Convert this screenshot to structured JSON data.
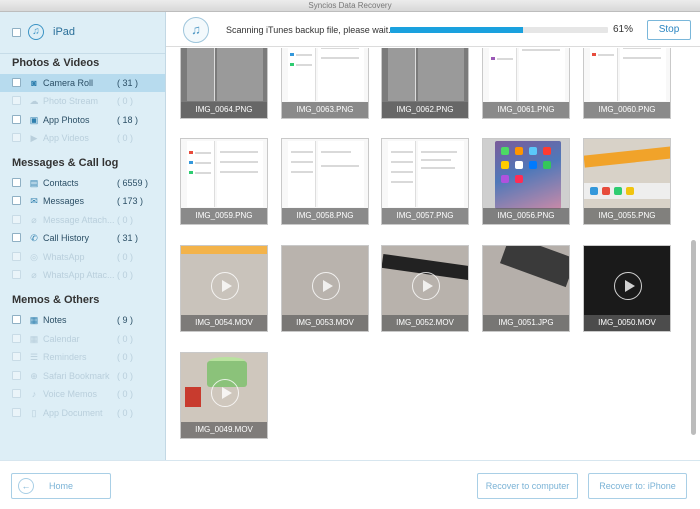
{
  "window": {
    "title": "Syncios Data Recovery"
  },
  "sidebar": {
    "device": {
      "name": "iPad",
      "icon": "music-note-icon"
    },
    "sections": [
      {
        "title": "Photos & Videos"
      },
      {
        "title": "Messages & Call log"
      },
      {
        "title": "Memos & Others"
      }
    ],
    "items": [
      {
        "label": "Camera Roll",
        "count": "( 31 )",
        "icon": "camera-icon"
      },
      {
        "label": "Photo Stream",
        "count": "( 0 )",
        "icon": "cloud-icon"
      },
      {
        "label": "App Photos",
        "count": "( 18 )",
        "icon": "image-icon"
      },
      {
        "label": "App Videos",
        "count": "( 0 )",
        "icon": "video-icon"
      },
      {
        "label": "Contacts",
        "count": "( 6559 )",
        "icon": "contacts-icon"
      },
      {
        "label": "Messages",
        "count": "( 173 )",
        "icon": "message-icon"
      },
      {
        "label": "Message Attach...",
        "count": "( 0 )",
        "icon": "attachment-icon"
      },
      {
        "label": "Call History",
        "count": "( 31 )",
        "icon": "phone-icon"
      },
      {
        "label": "WhatsApp",
        "count": "( 0 )",
        "icon": "whatsapp-icon"
      },
      {
        "label": "WhatsApp Attac...",
        "count": "( 0 )",
        "icon": "attachment-icon"
      },
      {
        "label": "Notes",
        "count": "( 9 )",
        "icon": "notes-icon"
      },
      {
        "label": "Calendar",
        "count": "( 0 )",
        "icon": "calendar-icon"
      },
      {
        "label": "Reminders",
        "count": "( 0 )",
        "icon": "reminder-icon"
      },
      {
        "label": "Safari Bookmark",
        "count": "( 0 )",
        "icon": "bookmark-icon"
      },
      {
        "label": "Voice Memos",
        "count": "( 0 )",
        "icon": "microphone-icon"
      },
      {
        "label": "App Document",
        "count": "( 0 )",
        "icon": "document-icon"
      }
    ]
  },
  "scan": {
    "status": "Scanning iTunes backup file, please wait...",
    "percent_label": "61%",
    "progress": 0.61,
    "stop_label": "Stop",
    "icon": "itunes-icon"
  },
  "thumbnails": [
    {
      "name": "IMG_0064.PNG"
    },
    {
      "name": "IMG_0063.PNG"
    },
    {
      "name": "IMG_0062.PNG"
    },
    {
      "name": "IMG_0061.PNG"
    },
    {
      "name": "IMG_0060.PNG"
    },
    {
      "name": "IMG_0059.PNG"
    },
    {
      "name": "IMG_0058.PNG"
    },
    {
      "name": "IMG_0057.PNG"
    },
    {
      "name": "IMG_0056.PNG"
    },
    {
      "name": "IMG_0055.PNG"
    },
    {
      "name": "IMG_0054.MOV"
    },
    {
      "name": "IMG_0053.MOV"
    },
    {
      "name": "IMG_0052.MOV"
    },
    {
      "name": "IMG_0051.JPG"
    },
    {
      "name": "IMG_0050.MOV"
    },
    {
      "name": "IMG_0049.MOV"
    }
  ],
  "footer": {
    "home_label": "Home",
    "recover_computer_label": "Recover to computer",
    "recover_iphone_label": "Recover to: iPhone"
  },
  "colors": {
    "accent": "#1aa1de",
    "sidebar_bg": "#ddeef6",
    "selected_bg": "#b7dbee"
  }
}
